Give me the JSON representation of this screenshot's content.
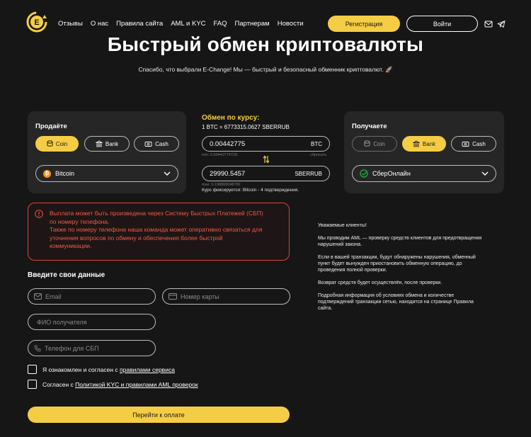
{
  "colors": {
    "accent": "#f5cd45",
    "background": "#161616",
    "panel": "#262626",
    "warning": "#ef5a44"
  },
  "header": {
    "logo_letter": "E",
    "nav": [
      "Отзывы",
      "О нас",
      "Правила сайта",
      "AML и KYC",
      "FAQ",
      "Партнерам",
      "Новости"
    ],
    "register_label": "Регистрация",
    "login_label": "Войти",
    "icons": [
      "mail-icon",
      "telegram-icon"
    ]
  },
  "hero": {
    "title": "Быстрый обмен криптовалюты",
    "subtitle": "Спасибо, что выбрали E-Change! Мы — быстрый и безопасный обменник криптовалют. 🚀"
  },
  "sell": {
    "title": "Продаёте",
    "tabs": [
      {
        "label": "Coin",
        "icon": "coin-icon",
        "active": true
      },
      {
        "label": "Bank",
        "icon": "bank-icon",
        "active": false
      },
      {
        "label": "Cash",
        "icon": "cash-icon",
        "active": false
      }
    ],
    "selected": "Bitcoin"
  },
  "exchange": {
    "title": "Обмен по курсу:",
    "rate": "1 BTC = 6773315.0627 SBERRUB",
    "give_value": "0.00442775",
    "give_currency": "BTC",
    "min_label": "min: 0.00442774728",
    "reset_label": "сбросить",
    "get_value": "29990.5457",
    "get_currency": "SBERRUB",
    "max_label": "max: 0.198868048782",
    "fix_note": "Курс фиксируется: Bitcoin - 4 подтверждения."
  },
  "buy": {
    "title": "Получаете",
    "tabs": [
      {
        "label": "Coin",
        "icon": "coin-icon",
        "active": false
      },
      {
        "label": "Bank",
        "icon": "bank-icon",
        "active": true
      },
      {
        "label": "Cash",
        "icon": "cash-icon",
        "active": false
      }
    ],
    "selected": "СберОнлайн"
  },
  "warning": {
    "lines": [
      "Выплата может быть произведена через Систему Быстрых Платежей (СБП)",
      "по номеру телефона.",
      "Также по номеру телефона наша команда может оперативно связаться для",
      "уточнения вопросов по обмену и обеспечения более быстрой",
      "коммуникации."
    ]
  },
  "info": {
    "paragraphs": [
      "Уважаемые клиенты!",
      "Мы проводим AML — проверку средств клиентов для предотвращения нарушений закона.",
      "Если в вашей транзакции, будут обнаружены нарушения, обменный пункт будет вынужден приостановить обменную операцию, до проведения полной проверки.",
      "Возврат средств будет осуществлён, после проверки.",
      "Подробная информация об условиях обмена и количестве подтверждений транзакции сетью, находится на странице Правила сайта."
    ]
  },
  "form": {
    "title": "Введите свои данные",
    "email_placeholder": "Email",
    "card_placeholder": "Номер карты",
    "name_placeholder": "ФИО получателя",
    "phone_placeholder": "Телефон для СБП",
    "agree1_text": "Я ознакомлен и согласен с ",
    "agree1_link": "правилами сервиса",
    "agree2_text": "Согласен с ",
    "agree2_link": "Политикой KYC и правилами AML проверок",
    "submit_label": "Перейти к оплате"
  }
}
